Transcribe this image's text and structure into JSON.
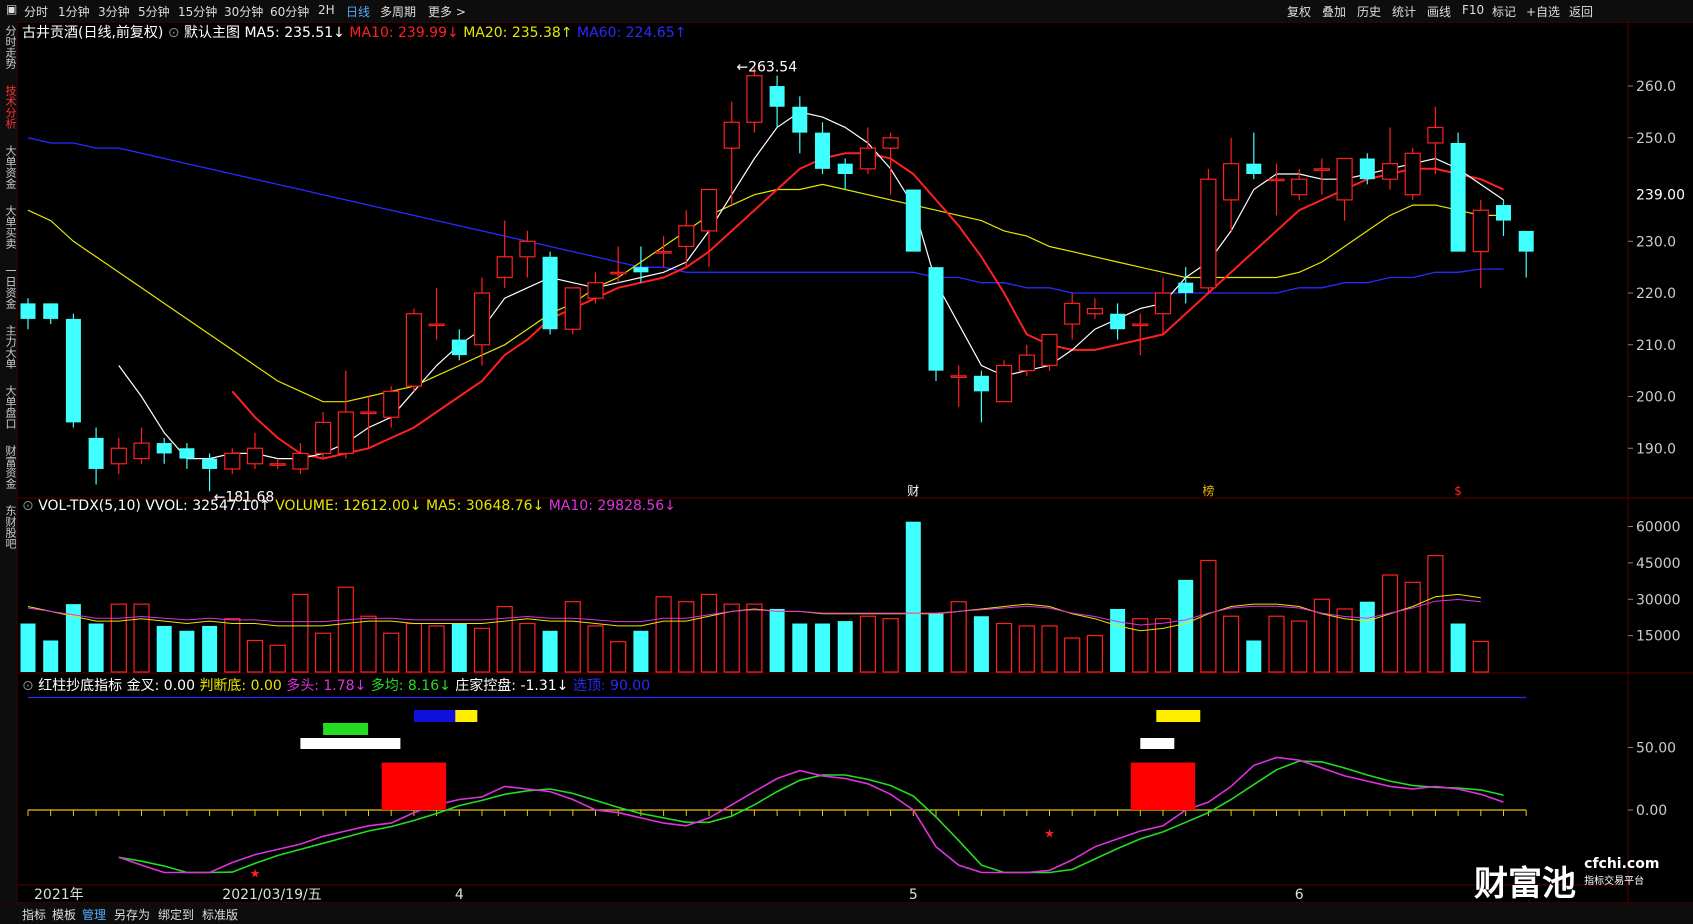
{
  "toolbar": {
    "left": [
      "分时",
      "1分钟",
      "3分钟",
      "5分钟",
      "15分钟",
      "30分钟",
      "60分钟",
      "2H",
      "日线",
      "多周期",
      "更多 >"
    ],
    "active": "日线",
    "right": [
      "复权",
      "叠加",
      "历史",
      "统计",
      "画线",
      "F10",
      "标记",
      "+自选",
      "返回"
    ]
  },
  "sidebar": [
    "分时走势",
    "技术分析",
    "大单资金",
    "大单买卖",
    "一日资金",
    "主力大单",
    "大单盘口",
    "财富资金",
    "东财股吧"
  ],
  "sidebar_active": "技术分析",
  "main_legend": {
    "title": "古井贡酒(日线,前复权)",
    "indicator": "默认主图",
    "items": [
      {
        "text": "MA5: 235.51↓",
        "color": "#ffffff"
      },
      {
        "text": "MA10: 239.99↓",
        "color": "#ff2020"
      },
      {
        "text": "MA20: 235.38↑",
        "color": "#e6e600"
      },
      {
        "text": "MA60: 224.65↑",
        "color": "#2a2aff"
      }
    ]
  },
  "vol_legend": {
    "title": "VOL-TDX(5,10) VVOL: 32547.10↑",
    "items": [
      {
        "text": "VOLUME: 12612.00↓",
        "color": "#e6e600"
      },
      {
        "text": "MA5: 30648.76↓",
        "color": "#e6e600"
      },
      {
        "text": "MA10: 29828.56↓",
        "color": "#dd33dd"
      }
    ]
  },
  "ind_legend": {
    "title": "红柱抄底指标",
    "items": [
      {
        "text": "金叉: 0.00",
        "color": "#ffffff"
      },
      {
        "text": "判断底: 0.00",
        "color": "#e6e600"
      },
      {
        "text": "多头: 1.78↓",
        "color": "#dd33dd"
      },
      {
        "text": "多均: 8.16↓",
        "color": "#22dd22"
      },
      {
        "text": "庄家控盘: -1.31↓",
        "color": "#ffffff"
      },
      {
        "text": "选顶: 90.00",
        "color": "#2a2aff"
      }
    ]
  },
  "annotations": {
    "high": "263.54",
    "low": "181.68",
    "current_price": "239.00"
  },
  "event_marks": [
    "财",
    "榜",
    "$"
  ],
  "x_labels": [
    "2021年",
    "2021/03/19/五",
    "4",
    "5",
    "6"
  ],
  "watermark": {
    "brand": "财富池",
    "url": "cfchi.com",
    "sub": "指标交易平台"
  },
  "bottom_tabs": [
    "指标",
    "模板",
    "管理",
    "另存为",
    "绑定到",
    "标准版"
  ],
  "bottom_active": "管理",
  "colors": {
    "up": "#ff2020",
    "down": "#40ffff",
    "ma5": "#ffffff",
    "ma10": "#ff2020",
    "ma20": "#e6e600",
    "ma60": "#2a2aff"
  },
  "chart_data": {
    "type": "candlestick",
    "price_ylim": [
      180,
      266
    ],
    "price_ticks": [
      "260.0",
      "250.0",
      "230.0",
      "220.0",
      "210.0",
      "200.0",
      "190.0"
    ],
    "vol_ticks": [
      "60000",
      "45000",
      "30000",
      "15000"
    ],
    "ind_ticks": [
      "50.00",
      "0.00"
    ],
    "candles": [
      {
        "o": 218,
        "c": 215,
        "h": 219,
        "l": 213
      },
      {
        "o": 218,
        "c": 215,
        "h": 218,
        "l": 214
      },
      {
        "o": 215,
        "c": 195,
        "h": 216,
        "l": 194
      },
      {
        "o": 192,
        "c": 186,
        "h": 194,
        "l": 183
      },
      {
        "o": 187,
        "c": 190,
        "h": 192,
        "l": 185
      },
      {
        "o": 188,
        "c": 191,
        "h": 194,
        "l": 187
      },
      {
        "o": 191,
        "c": 189,
        "h": 192,
        "l": 187
      },
      {
        "o": 190,
        "c": 188,
        "h": 191,
        "l": 186
      },
      {
        "o": 188,
        "c": 186,
        "h": 189,
        "l": 181.68
      },
      {
        "o": 186,
        "c": 189,
        "h": 190,
        "l": 185
      },
      {
        "o": 187,
        "c": 190,
        "h": 193,
        "l": 186
      },
      {
        "o": 187,
        "c": 187,
        "h": 188,
        "l": 186
      },
      {
        "o": 186,
        "c": 189,
        "h": 191,
        "l": 185
      },
      {
        "o": 189,
        "c": 195,
        "h": 197,
        "l": 188
      },
      {
        "o": 189,
        "c": 197,
        "h": 205,
        "l": 188
      },
      {
        "o": 197,
        "c": 197,
        "h": 200,
        "l": 190
      },
      {
        "o": 196,
        "c": 201,
        "h": 202,
        "l": 194
      },
      {
        "o": 202,
        "c": 216,
        "h": 217,
        "l": 201
      },
      {
        "o": 214,
        "c": 214,
        "h": 221,
        "l": 211
      },
      {
        "o": 211,
        "c": 208,
        "h": 213,
        "l": 207
      },
      {
        "o": 210,
        "c": 220,
        "h": 223,
        "l": 206
      },
      {
        "o": 223,
        "c": 227,
        "h": 234,
        "l": 221
      },
      {
        "o": 227,
        "c": 230,
        "h": 232,
        "l": 223
      },
      {
        "o": 227,
        "c": 213,
        "h": 228,
        "l": 212
      },
      {
        "o": 213,
        "c": 221,
        "h": 221,
        "l": 212
      },
      {
        "o": 219,
        "c": 222,
        "h": 224,
        "l": 218
      },
      {
        "o": 224,
        "c": 224,
        "h": 229,
        "l": 222
      },
      {
        "o": 225,
        "c": 224,
        "h": 229,
        "l": 222
      },
      {
        "o": 228,
        "c": 228,
        "h": 231,
        "l": 225
      },
      {
        "o": 229,
        "c": 233,
        "h": 236,
        "l": 225
      },
      {
        "o": 232,
        "c": 240,
        "h": 240,
        "l": 225
      },
      {
        "o": 248,
        "c": 253,
        "h": 257,
        "l": 237
      },
      {
        "o": 253,
        "c": 262,
        "h": 263.54,
        "l": 251
      },
      {
        "o": 260,
        "c": 256,
        "h": 262,
        "l": 252
      },
      {
        "o": 256,
        "c": 251,
        "h": 258,
        "l": 247
      },
      {
        "o": 251,
        "c": 244,
        "h": 253,
        "l": 243
      },
      {
        "o": 245,
        "c": 243,
        "h": 246,
        "l": 240
      },
      {
        "o": 244,
        "c": 248,
        "h": 252,
        "l": 243
      },
      {
        "o": 248,
        "c": 250,
        "h": 251,
        "l": 239
      },
      {
        "o": 240,
        "c": 228,
        "h": 240,
        "l": 228
      },
      {
        "o": 225,
        "c": 205,
        "h": 225,
        "l": 203
      },
      {
        "o": 204,
        "c": 204,
        "h": 206,
        "l": 198
      },
      {
        "o": 204,
        "c": 201,
        "h": 205,
        "l": 195
      },
      {
        "o": 199,
        "c": 206,
        "h": 207,
        "l": 199
      },
      {
        "o": 205,
        "c": 208,
        "h": 210,
        "l": 204
      },
      {
        "o": 206,
        "c": 212,
        "h": 212,
        "l": 205
      },
      {
        "o": 214,
        "c": 218,
        "h": 220,
        "l": 211
      },
      {
        "o": 216,
        "c": 217,
        "h": 219,
        "l": 215
      },
      {
        "o": 216,
        "c": 213,
        "h": 218,
        "l": 211
      },
      {
        "o": 214,
        "c": 214,
        "h": 216,
        "l": 208
      },
      {
        "o": 216,
        "c": 220,
        "h": 223,
        "l": 212
      },
      {
        "o": 222,
        "c": 220,
        "h": 225,
        "l": 218
      },
      {
        "o": 221,
        "c": 242,
        "h": 244,
        "l": 220
      },
      {
        "o": 238,
        "c": 245,
        "h": 250,
        "l": 232
      },
      {
        "o": 245,
        "c": 243,
        "h": 251,
        "l": 242
      },
      {
        "o": 242,
        "c": 242,
        "h": 245,
        "l": 235
      },
      {
        "o": 239,
        "c": 242,
        "h": 244,
        "l": 238
      },
      {
        "o": 244,
        "c": 244,
        "h": 246,
        "l": 239
      },
      {
        "o": 238,
        "c": 246,
        "h": 246,
        "l": 234
      },
      {
        "o": 246,
        "c": 242,
        "h": 247,
        "l": 241
      },
      {
        "o": 242,
        "c": 245,
        "h": 252,
        "l": 240
      },
      {
        "o": 239,
        "c": 247,
        "h": 248,
        "l": 238
      },
      {
        "o": 249,
        "c": 252,
        "h": 256,
        "l": 243
      },
      {
        "o": 249,
        "c": 228,
        "h": 251,
        "l": 228
      },
      {
        "o": 228,
        "c": 236,
        "h": 238,
        "l": 221
      },
      {
        "o": 237,
        "c": 234,
        "h": 238,
        "l": 231
      },
      {
        "o": 232,
        "c": 228,
        "h": 232,
        "l": 223
      }
    ],
    "volume": [
      20000,
      13000,
      28000,
      20000,
      28000,
      28000,
      19000,
      17000,
      19000,
      22000,
      13000,
      11000,
      32000,
      16000,
      35000,
      23000,
      16000,
      20000,
      19000,
      20000,
      18000,
      27000,
      20000,
      17000,
      29000,
      19000,
      12500,
      17000,
      31000,
      29000,
      32000,
      28000,
      28000,
      26000,
      20000,
      20000,
      21000,
      23000,
      22000,
      62000,
      24000,
      29000,
      23000,
      20000,
      19000,
      19000,
      14000,
      15000,
      26000,
      22000,
      22000,
      38000,
      46000,
      23000,
      13000,
      23000,
      21000,
      30000,
      26000,
      29000,
      40000,
      37000,
      48000,
      20000,
      12612
    ],
    "ma5": [
      null,
      null,
      null,
      null,
      206,
      200,
      193,
      188,
      188,
      189,
      189,
      188,
      188,
      189,
      191,
      194,
      196,
      201,
      206,
      210,
      213,
      219,
      221,
      223,
      222,
      221,
      222,
      223,
      224,
      226,
      232,
      239,
      246,
      252,
      255,
      254,
      252,
      249,
      244,
      237,
      222,
      214,
      206,
      204,
      205,
      206,
      209,
      213,
      215,
      217,
      218,
      223,
      226,
      232,
      240,
      243,
      243,
      242,
      242,
      243,
      244,
      245,
      246,
      244,
      241,
      238
    ],
    "ma10": [
      null,
      null,
      null,
      null,
      null,
      null,
      null,
      null,
      null,
      201,
      196,
      192,
      189,
      188,
      189,
      190,
      192,
      194,
      197,
      200,
      203,
      208,
      211,
      215,
      217,
      219,
      221,
      222,
      223,
      225,
      228,
      232,
      236,
      240,
      244,
      246,
      247,
      247,
      246,
      243,
      238,
      233,
      227,
      220,
      212,
      210,
      209,
      209,
      210,
      211,
      212,
      216,
      220,
      224,
      228,
      232,
      236,
      238,
      240,
      242,
      243,
      244,
      244,
      243,
      242,
      240
    ],
    "ma20": [
      236,
      234,
      230,
      227,
      224,
      221,
      218,
      215,
      212,
      209,
      206,
      203,
      201,
      199,
      199,
      200,
      201,
      202,
      204,
      206,
      208,
      210,
      213,
      216,
      218,
      221,
      223,
      226,
      229,
      232,
      235,
      237,
      239,
      240,
      240,
      241,
      240,
      239,
      238,
      237,
      236,
      235,
      234,
      232,
      231,
      229,
      228,
      227,
      226,
      225,
      224,
      223,
      223,
      223,
      223,
      223,
      224,
      226,
      229,
      232,
      235,
      237,
      237,
      236,
      235,
      235
    ],
    "ma60": [
      250,
      249,
      249,
      248,
      248,
      247,
      246,
      245,
      244,
      243,
      242,
      241,
      240,
      239,
      238,
      237,
      236,
      235,
      234,
      233,
      232,
      231,
      230,
      229,
      228,
      227,
      226,
      225,
      225,
      224,
      224,
      224,
      224,
      224,
      224,
      224,
      224,
      224,
      224,
      224,
      223,
      223,
      222,
      222,
      221,
      221,
      220,
      220,
      220,
      220,
      220,
      220,
      220,
      220,
      220,
      220,
      221,
      221,
      222,
      222,
      223,
      223,
      224,
      224,
      224.65,
      224.65
    ],
    "vol_ma5": [
      27000,
      25000,
      23000,
      21000,
      21000,
      22000,
      21000,
      20000,
      21000,
      20000,
      20000,
      19000,
      19000,
      19000,
      20000,
      21000,
      21000,
      20000,
      20000,
      20000,
      20000,
      21000,
      22000,
      21000,
      21000,
      20000,
      19000,
      19000,
      21000,
      21000,
      23000,
      25000,
      26000,
      25000,
      25000,
      24000,
      24000,
      24000,
      24000,
      24000,
      24000,
      25000,
      26000,
      27000,
      28000,
      27000,
      24000,
      22000,
      19000,
      17000,
      18000,
      20000,
      24000,
      27000,
      28000,
      28000,
      27000,
      24000,
      22000,
      21000,
      24000,
      27000,
      31000,
      32000,
      30648
    ]
  }
}
